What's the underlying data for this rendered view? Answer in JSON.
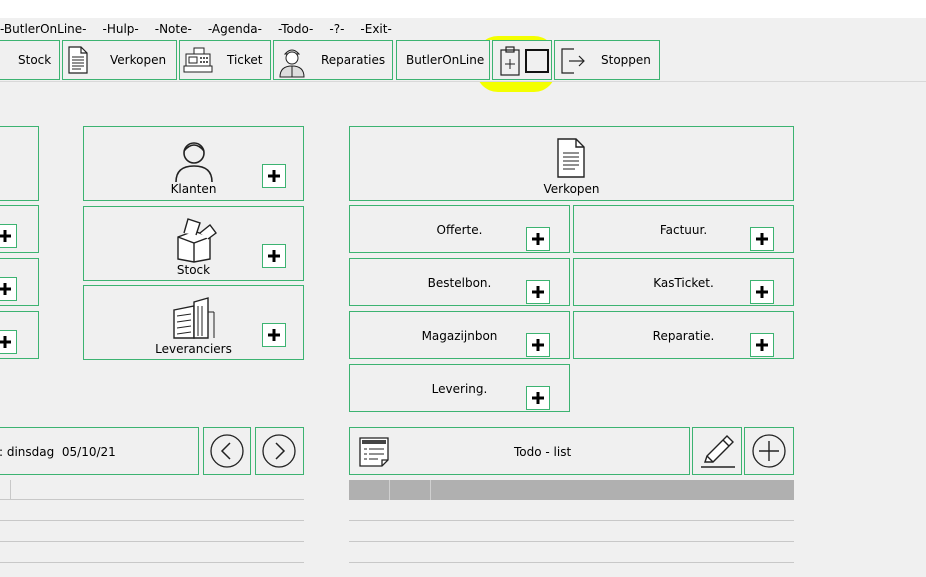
{
  "menu": [
    "-ButlerOnLine-",
    "-Hulp-",
    "-Note-",
    "-Agenda-",
    "-Todo-",
    "-?-",
    "-Exit-"
  ],
  "toolbar": {
    "stock": "Stock",
    "verkopen": "Verkopen",
    "ticket": "Ticket",
    "reparaties": "Reparaties",
    "butleronline": "ButlerOnLine",
    "stoppen": "Stoppen"
  },
  "tiles": {
    "klanten": "Klanten",
    "stock": "Stock",
    "leveranciers": "Leveranciers",
    "verkopen": "Verkopen",
    "offerte": "Offerte.",
    "factuur": "Factuur.",
    "bestelbon": "Bestelbon.",
    "kasticket": "KasTicket.",
    "magazijnbon": "Magazijnbon",
    "reparatie": "Reparatie.",
    "levering": "Levering."
  },
  "agenda": {
    "date_text": ": dinsdag  05/10/21"
  },
  "todo": {
    "title": "Todo - list"
  },
  "colors": {
    "accent": "#3cb371",
    "highlight": "#f4ff00"
  }
}
